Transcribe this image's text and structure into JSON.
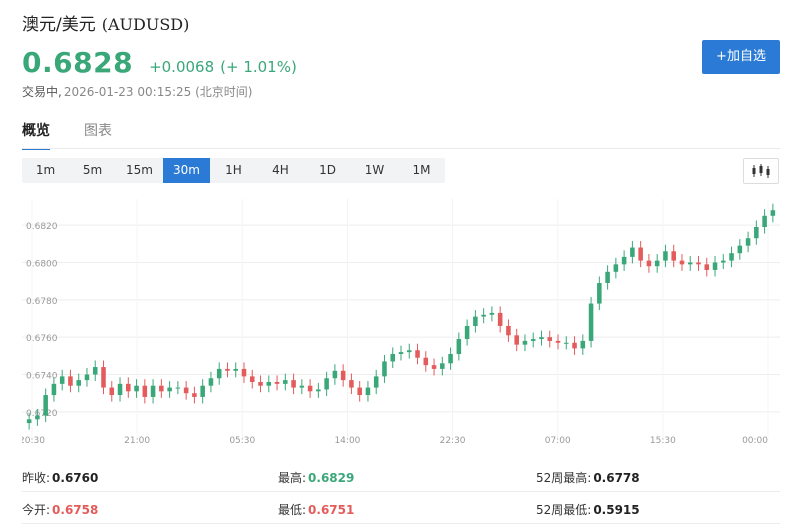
{
  "header": {
    "name": "澳元/美元",
    "symbol": "(AUDUSD)",
    "price": "0.6828",
    "change": "+0.0068",
    "change_pct": "(+ 1.01%)",
    "status": "交易中,",
    "timestamp": "2026-01-23 00:15:25 (北京时间)",
    "watchlist_button": "+加自选"
  },
  "tabs": [
    {
      "label": "概览",
      "active": true
    },
    {
      "label": "图表",
      "active": false
    }
  ],
  "intervals": [
    {
      "label": "1m",
      "active": false
    },
    {
      "label": "5m",
      "active": false
    },
    {
      "label": "15m",
      "active": false
    },
    {
      "label": "30m",
      "active": true
    },
    {
      "label": "1H",
      "active": false
    },
    {
      "label": "4H",
      "active": false
    },
    {
      "label": "1D",
      "active": false
    },
    {
      "label": "1W",
      "active": false
    },
    {
      "label": "1M",
      "active": false
    }
  ],
  "colors": {
    "up": "#3aa779",
    "down": "#e35b5b",
    "accent": "#2b7bd6"
  },
  "chart_data": {
    "type": "candlestick",
    "interval": "30m",
    "y_ticks": [
      "0.6720",
      "0.6740",
      "0.6760",
      "0.6780",
      "0.6800",
      "0.6820"
    ],
    "x_ticks": [
      "20:30",
      "21:00",
      "05:30",
      "14:00",
      "22:30",
      "07:00",
      "15:30",
      "00:00"
    ],
    "ylim": [
      0.6706,
      0.6834
    ],
    "grid": true,
    "closes": [
      0.6716,
      0.6718,
      0.6729,
      0.6735,
      0.6739,
      0.6734,
      0.6737,
      0.674,
      0.6744,
      0.6733,
      0.6729,
      0.6735,
      0.6731,
      0.6734,
      0.6728,
      0.6734,
      0.6731,
      0.6733,
      0.6733,
      0.673,
      0.6728,
      0.6734,
      0.6738,
      0.6743,
      0.6742,
      0.6743,
      0.6739,
      0.6736,
      0.6734,
      0.6736,
      0.6735,
      0.6737,
      0.6733,
      0.6734,
      0.6731,
      0.6732,
      0.6738,
      0.6742,
      0.6737,
      0.6733,
      0.6729,
      0.6733,
      0.6739,
      0.6747,
      0.6751,
      0.6752,
      0.6753,
      0.6749,
      0.6745,
      0.6743,
      0.6746,
      0.6751,
      0.6759,
      0.6766,
      0.6771,
      0.6772,
      0.6773,
      0.6766,
      0.6761,
      0.6756,
      0.6758,
      0.6759,
      0.676,
      0.6758,
      0.6757,
      0.6757,
      0.6754,
      0.6758,
      0.6778,
      0.6789,
      0.6795,
      0.6799,
      0.6803,
      0.6808,
      0.6801,
      0.6798,
      0.6801,
      0.6806,
      0.6801,
      0.6799,
      0.68,
      0.6799,
      0.6796,
      0.68,
      0.6801,
      0.6805,
      0.6809,
      0.6813,
      0.6819,
      0.6825,
      0.6828
    ]
  },
  "stats": [
    [
      {
        "label": "昨收:",
        "value": "0.6760",
        "tone": "neutral"
      },
      {
        "label": "最高:",
        "value": "0.6829",
        "tone": "up"
      },
      {
        "label": "52周最高:",
        "value": "0.6778",
        "tone": "neutral"
      }
    ],
    [
      {
        "label": "今开:",
        "value": "0.6758",
        "tone": "down"
      },
      {
        "label": "最低:",
        "value": "0.6751",
        "tone": "down"
      },
      {
        "label": "52周最低:",
        "value": "0.5915",
        "tone": "neutral"
      }
    ]
  ]
}
